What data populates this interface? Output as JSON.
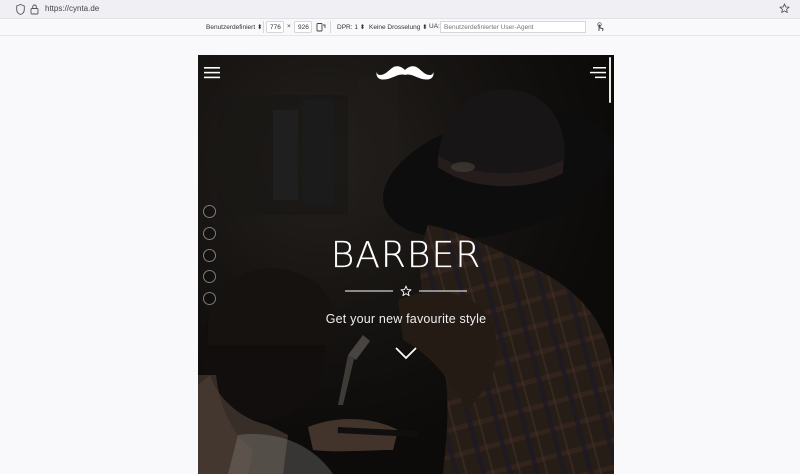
{
  "browser": {
    "url": "https://cynta.de",
    "icons": [
      "shield-icon",
      "lock-icon",
      "bookmark-star-icon"
    ]
  },
  "responsive_toolbar": {
    "device": "Benutzerdefiniert",
    "width": "776",
    "times": "×",
    "height": "926",
    "dpr": "DPR: 1",
    "throttling": "Keine Drosselung",
    "ua_label": "UA:",
    "ua_placeholder": "Benutzerdefinierter User-Agent",
    "icons": [
      "rotate-icon",
      "touch-icon"
    ]
  },
  "site": {
    "title": "BARBER",
    "subtitle": "Get your new favourite style",
    "section_dots": 5,
    "colors": {
      "overlay": "#1a1716",
      "text": "#ffffff"
    },
    "icons": [
      "hamburger-menu-icon",
      "mustache-logo",
      "menu-lines-icon",
      "star-icon",
      "chevron-down-icon"
    ]
  }
}
